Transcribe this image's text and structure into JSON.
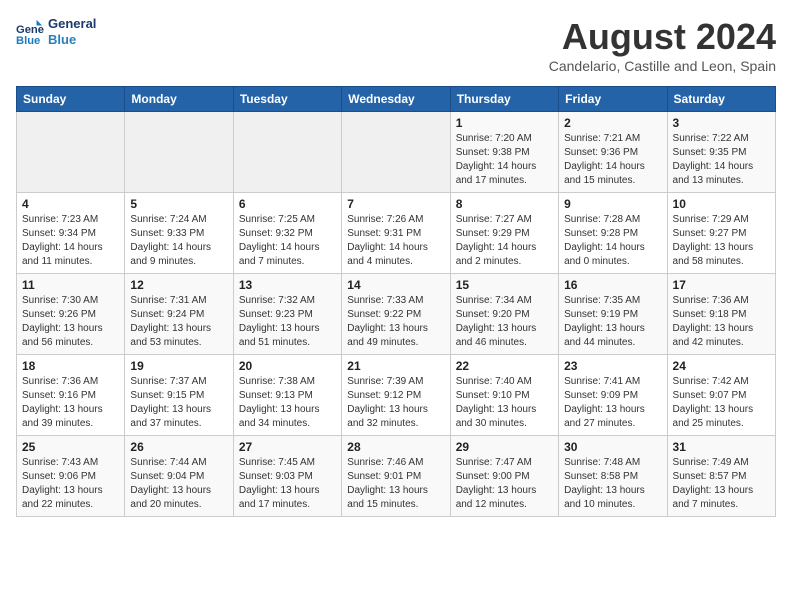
{
  "header": {
    "logo_line1": "General",
    "logo_line2": "Blue",
    "month_year": "August 2024",
    "location": "Candelario, Castille and Leon, Spain"
  },
  "weekdays": [
    "Sunday",
    "Monday",
    "Tuesday",
    "Wednesday",
    "Thursday",
    "Friday",
    "Saturday"
  ],
  "weeks": [
    [
      {
        "day": "",
        "info": ""
      },
      {
        "day": "",
        "info": ""
      },
      {
        "day": "",
        "info": ""
      },
      {
        "day": "",
        "info": ""
      },
      {
        "day": "1",
        "info": "Sunrise: 7:20 AM\nSunset: 9:38 PM\nDaylight: 14 hours\nand 17 minutes."
      },
      {
        "day": "2",
        "info": "Sunrise: 7:21 AM\nSunset: 9:36 PM\nDaylight: 14 hours\nand 15 minutes."
      },
      {
        "day": "3",
        "info": "Sunrise: 7:22 AM\nSunset: 9:35 PM\nDaylight: 14 hours\nand 13 minutes."
      }
    ],
    [
      {
        "day": "4",
        "info": "Sunrise: 7:23 AM\nSunset: 9:34 PM\nDaylight: 14 hours\nand 11 minutes."
      },
      {
        "day": "5",
        "info": "Sunrise: 7:24 AM\nSunset: 9:33 PM\nDaylight: 14 hours\nand 9 minutes."
      },
      {
        "day": "6",
        "info": "Sunrise: 7:25 AM\nSunset: 9:32 PM\nDaylight: 14 hours\nand 7 minutes."
      },
      {
        "day": "7",
        "info": "Sunrise: 7:26 AM\nSunset: 9:31 PM\nDaylight: 14 hours\nand 4 minutes."
      },
      {
        "day": "8",
        "info": "Sunrise: 7:27 AM\nSunset: 9:29 PM\nDaylight: 14 hours\nand 2 minutes."
      },
      {
        "day": "9",
        "info": "Sunrise: 7:28 AM\nSunset: 9:28 PM\nDaylight: 14 hours\nand 0 minutes."
      },
      {
        "day": "10",
        "info": "Sunrise: 7:29 AM\nSunset: 9:27 PM\nDaylight: 13 hours\nand 58 minutes."
      }
    ],
    [
      {
        "day": "11",
        "info": "Sunrise: 7:30 AM\nSunset: 9:26 PM\nDaylight: 13 hours\nand 56 minutes."
      },
      {
        "day": "12",
        "info": "Sunrise: 7:31 AM\nSunset: 9:24 PM\nDaylight: 13 hours\nand 53 minutes."
      },
      {
        "day": "13",
        "info": "Sunrise: 7:32 AM\nSunset: 9:23 PM\nDaylight: 13 hours\nand 51 minutes."
      },
      {
        "day": "14",
        "info": "Sunrise: 7:33 AM\nSunset: 9:22 PM\nDaylight: 13 hours\nand 49 minutes."
      },
      {
        "day": "15",
        "info": "Sunrise: 7:34 AM\nSunset: 9:20 PM\nDaylight: 13 hours\nand 46 minutes."
      },
      {
        "day": "16",
        "info": "Sunrise: 7:35 AM\nSunset: 9:19 PM\nDaylight: 13 hours\nand 44 minutes."
      },
      {
        "day": "17",
        "info": "Sunrise: 7:36 AM\nSunset: 9:18 PM\nDaylight: 13 hours\nand 42 minutes."
      }
    ],
    [
      {
        "day": "18",
        "info": "Sunrise: 7:36 AM\nSunset: 9:16 PM\nDaylight: 13 hours\nand 39 minutes."
      },
      {
        "day": "19",
        "info": "Sunrise: 7:37 AM\nSunset: 9:15 PM\nDaylight: 13 hours\nand 37 minutes."
      },
      {
        "day": "20",
        "info": "Sunrise: 7:38 AM\nSunset: 9:13 PM\nDaylight: 13 hours\nand 34 minutes."
      },
      {
        "day": "21",
        "info": "Sunrise: 7:39 AM\nSunset: 9:12 PM\nDaylight: 13 hours\nand 32 minutes."
      },
      {
        "day": "22",
        "info": "Sunrise: 7:40 AM\nSunset: 9:10 PM\nDaylight: 13 hours\nand 30 minutes."
      },
      {
        "day": "23",
        "info": "Sunrise: 7:41 AM\nSunset: 9:09 PM\nDaylight: 13 hours\nand 27 minutes."
      },
      {
        "day": "24",
        "info": "Sunrise: 7:42 AM\nSunset: 9:07 PM\nDaylight: 13 hours\nand 25 minutes."
      }
    ],
    [
      {
        "day": "25",
        "info": "Sunrise: 7:43 AM\nSunset: 9:06 PM\nDaylight: 13 hours\nand 22 minutes."
      },
      {
        "day": "26",
        "info": "Sunrise: 7:44 AM\nSunset: 9:04 PM\nDaylight: 13 hours\nand 20 minutes."
      },
      {
        "day": "27",
        "info": "Sunrise: 7:45 AM\nSunset: 9:03 PM\nDaylight: 13 hours\nand 17 minutes."
      },
      {
        "day": "28",
        "info": "Sunrise: 7:46 AM\nSunset: 9:01 PM\nDaylight: 13 hours\nand 15 minutes."
      },
      {
        "day": "29",
        "info": "Sunrise: 7:47 AM\nSunset: 9:00 PM\nDaylight: 13 hours\nand 12 minutes."
      },
      {
        "day": "30",
        "info": "Sunrise: 7:48 AM\nSunset: 8:58 PM\nDaylight: 13 hours\nand 10 minutes."
      },
      {
        "day": "31",
        "info": "Sunrise: 7:49 AM\nSunset: 8:57 PM\nDaylight: 13 hours\nand 7 minutes."
      }
    ]
  ]
}
